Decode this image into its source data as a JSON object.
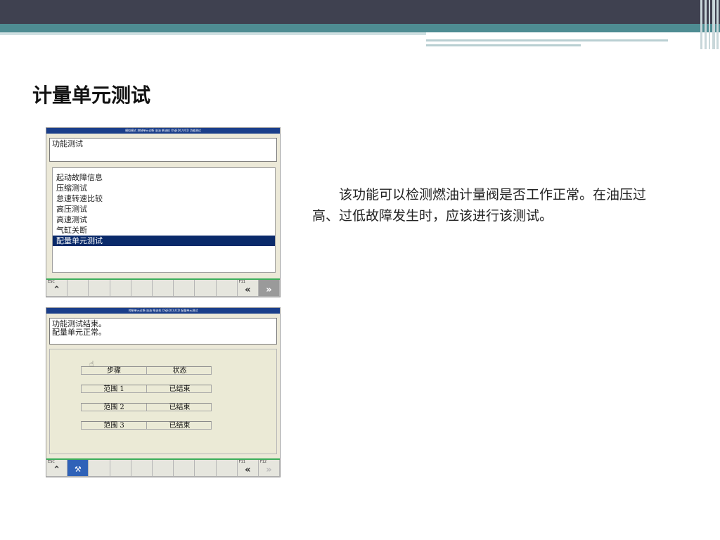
{
  "slide": {
    "title": "计量单元测试",
    "body": "该功能可以检测燃油计量阀是否工作正常。在油压过高、过低故障发生时，应该进行该测试。"
  },
  "screen1": {
    "titlebar": "模拟模式 控制单元诊断 溢油 柴油机 OSJEDC/UCD 功能测试",
    "message": "功能测试",
    "list": [
      "起动故障信息",
      "压缩测试",
      "怠速转速比较",
      "高压测试",
      "高速测试",
      "气缸关断",
      "配量单元测试"
    ],
    "selected_index": 6,
    "toolbar": {
      "esc_label": "ESC",
      "f11_label": "F11"
    }
  },
  "screen2": {
    "titlebar": "控制单元诊断 溢油 柴油机 OSJEDC/UCD 配量单元测试",
    "message_lines": [
      "功能测试结束。",
      "配量单元正常。"
    ],
    "table": {
      "header": [
        "步骤",
        "状态"
      ],
      "rows": [
        [
          "范围 1",
          "已结束"
        ],
        [
          "范围 2",
          "已结束"
        ],
        [
          "范围 3",
          "已结束"
        ]
      ]
    },
    "toolbar": {
      "esc_label": "ESC",
      "f11_label": "F11",
      "f12_label": "F12"
    }
  },
  "icons": {
    "home": "chevron-up-double-icon",
    "prev": "chevron-left-double-icon",
    "next": "chevron-right-double-icon",
    "tool": "wrench-icon",
    "pointer": "hand-pointer-icon"
  },
  "colors": {
    "header_dark": "#3f4150",
    "header_teal": "#4e8c92",
    "titlebar_blue": "#1a3e8a",
    "selection": "#0a2a6a",
    "toolbar_green": "#3cae5a"
  }
}
